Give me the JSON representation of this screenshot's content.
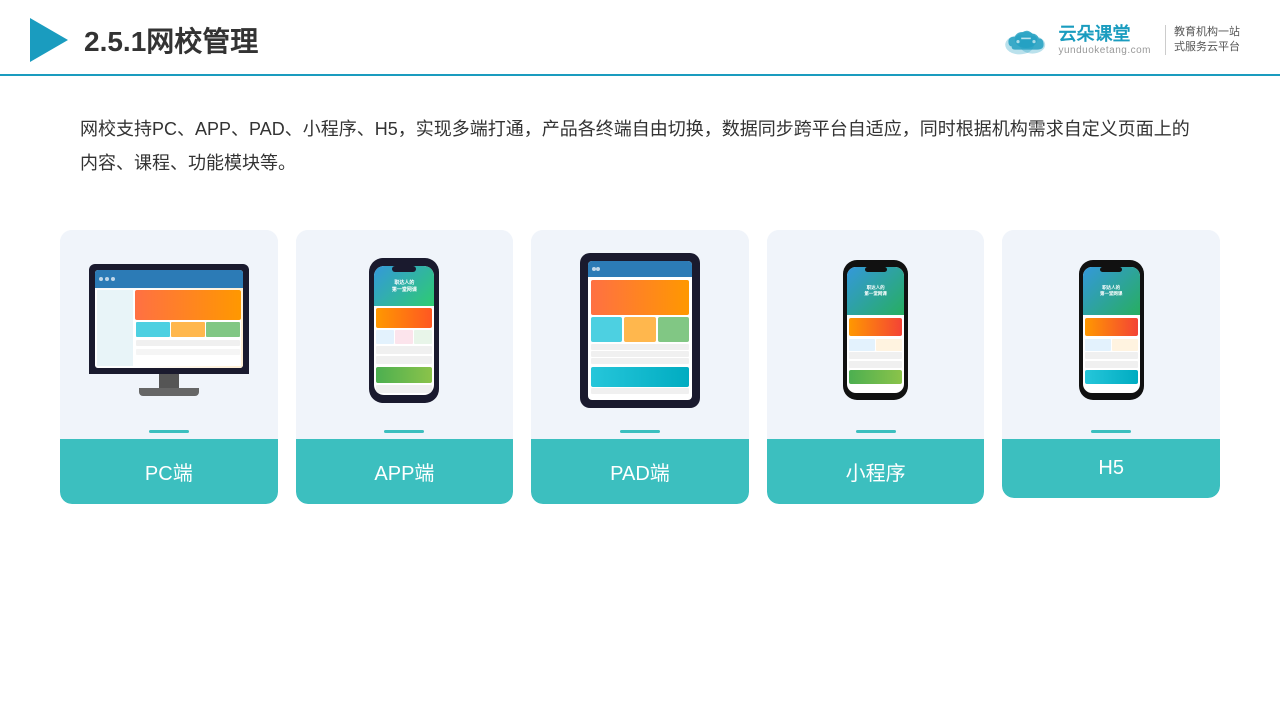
{
  "header": {
    "title": "2.5.1网校管理",
    "brand_name": "云朵课堂",
    "brand_url": "yunduoketang.com",
    "brand_slogan_line1": "教育机构一站",
    "brand_slogan_line2": "式服务云平台"
  },
  "description": {
    "text": "网校支持PC、APP、PAD、小程序、H5，实现多端打通，产品各终端自由切换，数据同步跨平台自适应，同时根据机构需求自定义页面上的内容、课程、功能模块等。"
  },
  "cards": [
    {
      "label": "PC端"
    },
    {
      "label": "APP端"
    },
    {
      "label": "PAD端"
    },
    {
      "label": "小程序"
    },
    {
      "label": "H5"
    }
  ]
}
